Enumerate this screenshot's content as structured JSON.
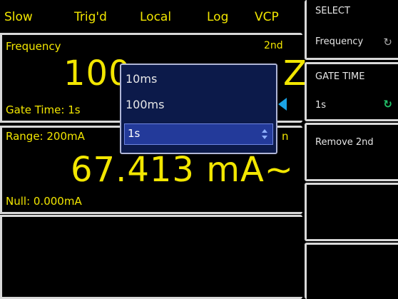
{
  "status_bar": {
    "items": [
      "Slow",
      "Trig'd",
      "Local",
      "Log",
      "VCP"
    ]
  },
  "panel_frequency": {
    "label": "Frequency",
    "badge": "2nd",
    "value_partial": "100",
    "value_tail": "Z",
    "gate_time": "Gate Time: 1s"
  },
  "panel_current": {
    "range": "Range: 200mA",
    "badge_tail": "n",
    "value": "67.413 mA~",
    "null": "Null: 0.000mA"
  },
  "softkeys": {
    "select_title": "SELECT",
    "select_value": "Frequency",
    "gate_title": "GATE TIME",
    "gate_value": "1s",
    "remove": "Remove 2nd"
  },
  "dropdown": {
    "options": [
      "10ms",
      "100ms",
      "1s"
    ],
    "selected": "1s"
  },
  "colors": {
    "text_yellow": "#f2e600",
    "frame": "#d9d9d9",
    "dropdown_bg": "#0c1a4a",
    "selected_bg": "#233a9a",
    "pointer": "#1ba3e6",
    "knob_green": "#22c36a"
  }
}
